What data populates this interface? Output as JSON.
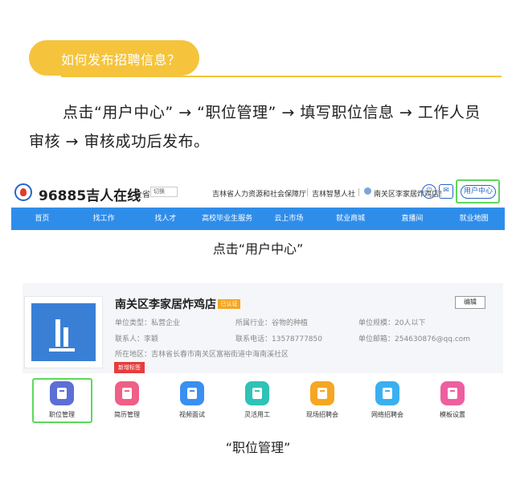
{
  "heading": "如何发布招聘信息？",
  "instruction": "点击“用户中心” → “职位管理” → 填写职位信息 → 工作人员审核 → 审核成功后发布。",
  "site_header": {
    "logo_text": "96885吉人在线",
    "province": "全省",
    "province_select": "切换",
    "links": [
      "吉林省人力资源和社会保障厅",
      "吉林智慧人社"
    ],
    "user_name": "南关区李家居炸鸡店！",
    "power_glyph": "⏻",
    "mail_glyph": "✉",
    "user_center": "用户中心"
  },
  "nav": [
    "首页",
    "找工作",
    "找人才",
    "高校毕业生服务",
    "云上市场",
    "就业商城",
    "直播间",
    "就业地图"
  ],
  "captions": {
    "first": "点击“用户中心”",
    "second": "“职位管理”"
  },
  "company": {
    "name": "南关区李家居炸鸡店",
    "verified": "已认证",
    "edit": "编辑",
    "type": "单位类型：私营企业",
    "industry": "所属行业：谷物的种植",
    "size": "单位规模：20人以下",
    "contact": "联系人：李颖",
    "phone": "联系电话：13578777850",
    "email": "单位邮箱：254630876@qq.com",
    "address": "所在地区：吉林省长春市南关区富裕街道中海南溪社区",
    "new_tag": "新增标签"
  },
  "functions": [
    {
      "label": "职位管理",
      "color": "#5b6fd6"
    },
    {
      "label": "简历管理",
      "color": "#ef5f86"
    },
    {
      "label": "视频面试",
      "color": "#3a8ff0"
    },
    {
      "label": "灵活用工",
      "color": "#2fc2b6"
    },
    {
      "label": "现场招聘会",
      "color": "#f5a623"
    },
    {
      "label": "网络招聘会",
      "color": "#3ab0f0"
    },
    {
      "label": "模板设置",
      "color": "#ee5fa0"
    }
  ]
}
